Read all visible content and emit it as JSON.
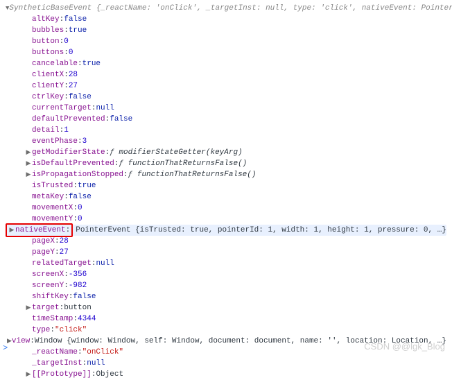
{
  "header": {
    "typeName": "SyntheticBaseEvent",
    "summary": "{_reactName: 'onClick', _targetInst: null, type: 'click', nativeEvent: PointerEvent,"
  },
  "props": {
    "altKey": "false",
    "bubbles": "true",
    "button": "0",
    "buttons": "0",
    "cancelable": "true",
    "clientX": "28",
    "clientY": "27",
    "ctrlKey": "false",
    "currentTarget": "null",
    "defaultPrevented": "false",
    "detail": "1",
    "eventPhase": "3",
    "getModifierState": "modifierStateGetter(keyArg)",
    "isDefaultPrevented": "functionThatReturnsFalse()",
    "isPropagationStopped": "functionThatReturnsFalse()",
    "isTrusted": "true",
    "metaKey": "false",
    "movementX": "0",
    "movementY": "0",
    "nativeEventKey": "nativeEvent",
    "nativeEventSummary": "PointerEvent {isTrusted: true, pointerId: 1, width: 1, height: 1, pressure: 0, …}",
    "pageX": "28",
    "pageY": "27",
    "relatedTarget": "null",
    "screenX": "-356",
    "screenY": "-982",
    "shiftKey": "false",
    "target": "button",
    "timeStamp": "4344",
    "type": "\"click\"",
    "viewSummary": "Window {window: Window, self: Window, document: document, name: '', location: Location, …}",
    "_reactName": "\"onClick\"",
    "_targetInst": "null",
    "prototype": "Object"
  },
  "labels": {
    "fnSymbol": "ƒ",
    "viewKey": "view",
    "viewType": "Window",
    "protoKey": "[[Prototype]]"
  },
  "watermark": "CSDN @@lgk_Blog",
  "prompt": ">"
}
